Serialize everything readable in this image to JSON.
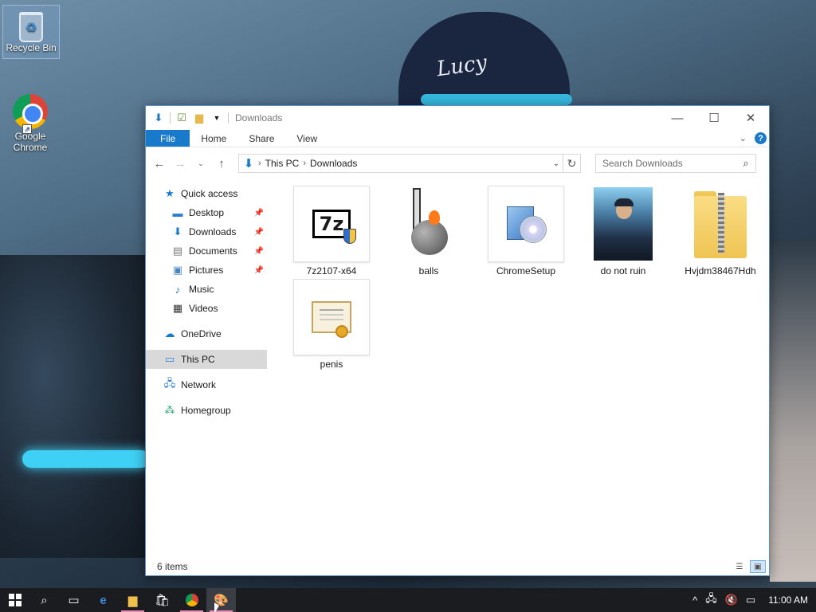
{
  "desktop": {
    "icons": [
      {
        "label": "Recycle Bin",
        "icon": "recycle-bin-icon"
      },
      {
        "label": "Google Chrome",
        "icon": "chrome-icon"
      }
    ],
    "wallpaper_hat_text": "Lucy"
  },
  "window": {
    "title": "Downloads",
    "controls": {
      "minimize": "—",
      "maximize": "☐",
      "close": "✕"
    },
    "ribbon_tabs": [
      "File",
      "Home",
      "Share",
      "View"
    ],
    "address": {
      "crumbs": [
        "This PC",
        "Downloads"
      ]
    },
    "search": {
      "placeholder": "Search Downloads"
    },
    "sidebar": {
      "quick_access": "Quick access",
      "quick_items": [
        {
          "label": "Desktop",
          "icon": "desktop-folder-icon",
          "pinned": true
        },
        {
          "label": "Downloads",
          "icon": "downloads-folder-icon",
          "pinned": true
        },
        {
          "label": "Documents",
          "icon": "documents-folder-icon",
          "pinned": true
        },
        {
          "label": "Pictures",
          "icon": "pictures-folder-icon",
          "pinned": true
        },
        {
          "label": "Music",
          "icon": "music-folder-icon",
          "pinned": false
        },
        {
          "label": "Videos",
          "icon": "videos-folder-icon",
          "pinned": false
        }
      ],
      "onedrive": "OneDrive",
      "this_pc": "This PC",
      "network": "Network",
      "homegroup": "Homegroup"
    },
    "files": [
      {
        "name": "7z2107-x64",
        "icon": "7zip-installer-icon"
      },
      {
        "name": "balls",
        "icon": "image-thumbnail-icon"
      },
      {
        "name": "ChromeSetup",
        "icon": "setup-installer-icon"
      },
      {
        "name": "do not ruin",
        "icon": "photo-thumbnail-icon"
      },
      {
        "name": "Hvjdm38467Hdh",
        "icon": "zip-folder-icon"
      },
      {
        "name": "penis",
        "icon": "certificate-icon"
      }
    ],
    "status": "6 items"
  },
  "taskbar": {
    "clock": "11:00 AM",
    "pinned": [
      "start-icon",
      "search-icon",
      "task-view-icon",
      "edge-icon",
      "file-explorer-icon",
      "store-icon",
      "chrome-icon",
      "paint-icon"
    ]
  },
  "colors": {
    "accent": "#1979ca",
    "taskbar": "#1a1c20",
    "selection": "#d9d9d9"
  }
}
